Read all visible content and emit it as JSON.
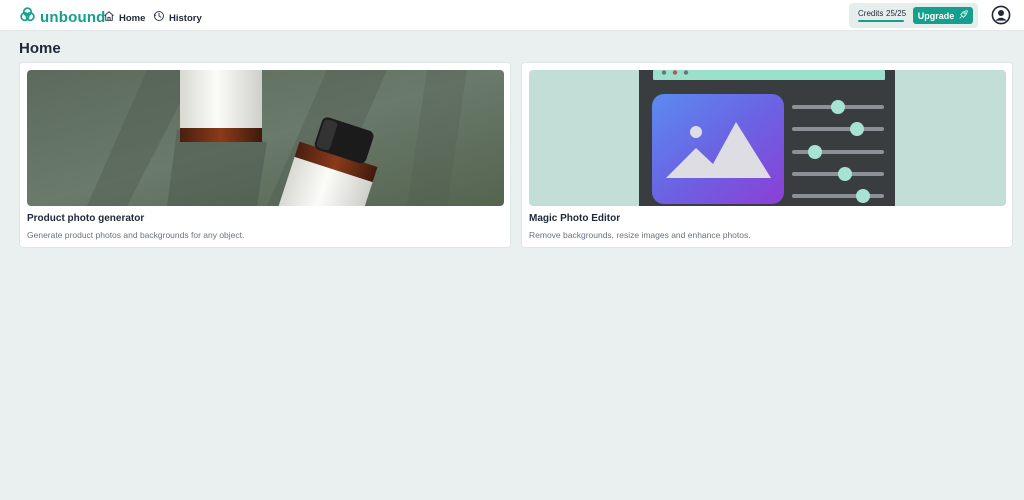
{
  "brand": {
    "name": "unbound",
    "accent": "#14a08c"
  },
  "nav": {
    "items": [
      {
        "label": "Home",
        "icon": "home-icon"
      },
      {
        "label": "History",
        "icon": "history-icon"
      }
    ]
  },
  "credits": {
    "label": "Credits",
    "count": "25/25",
    "used_fraction": 1.0,
    "upgrade_label": "Upgrade",
    "upgrade_icon": "rocket-icon"
  },
  "user": {
    "avatar_icon": "user-icon"
  },
  "page": {
    "title": "Home"
  },
  "cards": [
    {
      "title": "Product photo generator",
      "description": "Generate product photos and backgrounds for any object.",
      "image": "product-bottles-image"
    },
    {
      "title": "Magic Photo Editor",
      "description": "Remove backgrounds, resize images and enhance photos.",
      "image": "photo-editor-illustration"
    }
  ]
}
